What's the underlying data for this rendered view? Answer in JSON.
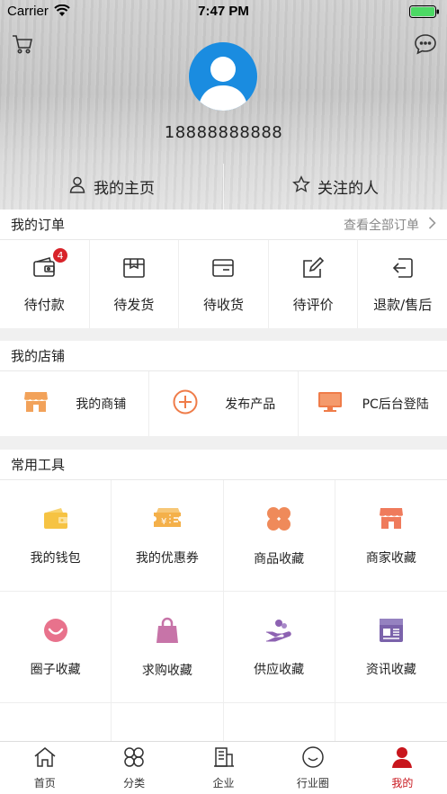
{
  "status": {
    "carrier": "Carrier",
    "time": "7:47 PM"
  },
  "profile": {
    "phone": "18888888888",
    "my_home": "我的主页",
    "following": "关注的人"
  },
  "orders": {
    "title": "我的订单",
    "view_all": "查看全部订单",
    "items": [
      {
        "label": "待付款",
        "badge": "4",
        "icon": "wallet-icon"
      },
      {
        "label": "待发货",
        "icon": "package-icon"
      },
      {
        "label": "待收货",
        "icon": "box-receive-icon"
      },
      {
        "label": "待评价",
        "icon": "edit-icon"
      },
      {
        "label": "退款/售后",
        "icon": "return-icon"
      }
    ]
  },
  "shop": {
    "title": "我的店铺",
    "items": [
      {
        "label": "我的商铺",
        "icon": "store-icon"
      },
      {
        "label": "发布产品",
        "icon": "plus-circle-icon"
      },
      {
        "label": "PC后台登陆",
        "icon": "monitor-icon"
      }
    ]
  },
  "tools": {
    "title": "常用工具",
    "items": [
      {
        "label": "我的钱包",
        "icon": "wallet-icon",
        "color": "#f6c343"
      },
      {
        "label": "我的优惠券",
        "icon": "coupon-icon",
        "color": "#f4b04a"
      },
      {
        "label": "商品收藏",
        "icon": "clover-icon",
        "color": "#ef8a5a"
      },
      {
        "label": "商家收藏",
        "icon": "store-icon",
        "color": "#ef7b5c"
      },
      {
        "label": "圈子收藏",
        "icon": "smile-icon",
        "color": "#e8728c"
      },
      {
        "label": "求购收藏",
        "icon": "bag-icon",
        "color": "#c774a8"
      },
      {
        "label": "供应收藏",
        "icon": "hand-icon",
        "color": "#8d62b2"
      },
      {
        "label": "资讯收藏",
        "icon": "news-icon",
        "color": "#7b63ab"
      }
    ]
  },
  "tabbar": {
    "items": [
      {
        "label": "首页",
        "icon": "home-icon"
      },
      {
        "label": "分类",
        "icon": "category-icon"
      },
      {
        "label": "企业",
        "icon": "building-icon"
      },
      {
        "label": "行业圈",
        "icon": "circle-icon"
      },
      {
        "label": "我的",
        "icon": "user-icon",
        "active": true
      }
    ]
  },
  "colors": {
    "accent": "#c8161d",
    "avatar": "#1a8ce0",
    "badge": "#d8232a"
  }
}
